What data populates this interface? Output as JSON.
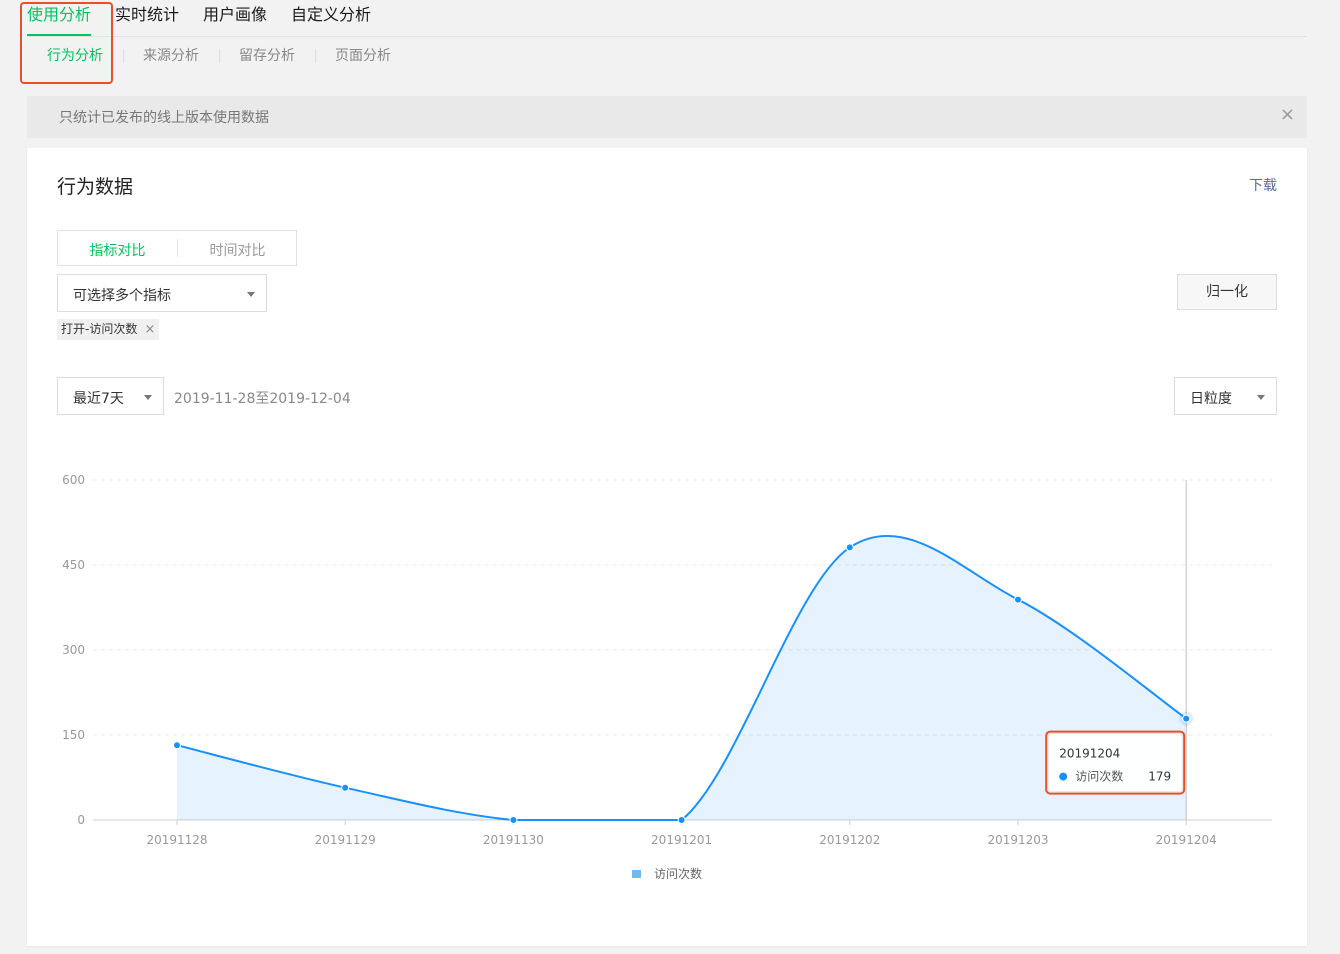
{
  "nav": {
    "top_tabs": [
      "使用分析",
      "实时统计",
      "用户画像",
      "自定义分析"
    ],
    "sub_tabs": [
      "行为分析",
      "来源分析",
      "留存分析",
      "页面分析"
    ]
  },
  "notice": {
    "text": "只统计已发布的线上版本使用数据",
    "close": "×"
  },
  "panel": {
    "title": "行为数据",
    "download": "下载",
    "seg": [
      "指标对比",
      "时间对比"
    ],
    "metric_placeholder": "可选择多个指标",
    "normalize": "归一化",
    "chip_label": "打开-访问次数",
    "chip_close": "×",
    "period_select": "最近7天",
    "range_text": "2019-11-28至2019-12-04",
    "granularity": "日粒度"
  },
  "colors": {
    "accent": "#07c160",
    "series": "#1890ff",
    "highlight": "#e8502a"
  },
  "chart_data": {
    "type": "area",
    "categories": [
      "20191128",
      "20191129",
      "20191130",
      "20191201",
      "20191202",
      "20191203",
      "20191204"
    ],
    "series": [
      {
        "name": "访问次数",
        "values": [
          132,
          57,
          0,
          0,
          481,
          389,
          179
        ]
      }
    ],
    "ylim": [
      0,
      600
    ],
    "yticks": [
      0,
      150,
      300,
      450,
      600
    ],
    "grid": true,
    "legend": "bottom-center",
    "tooltip": {
      "category": "20191204",
      "series": "访问次数",
      "value": 179
    }
  }
}
